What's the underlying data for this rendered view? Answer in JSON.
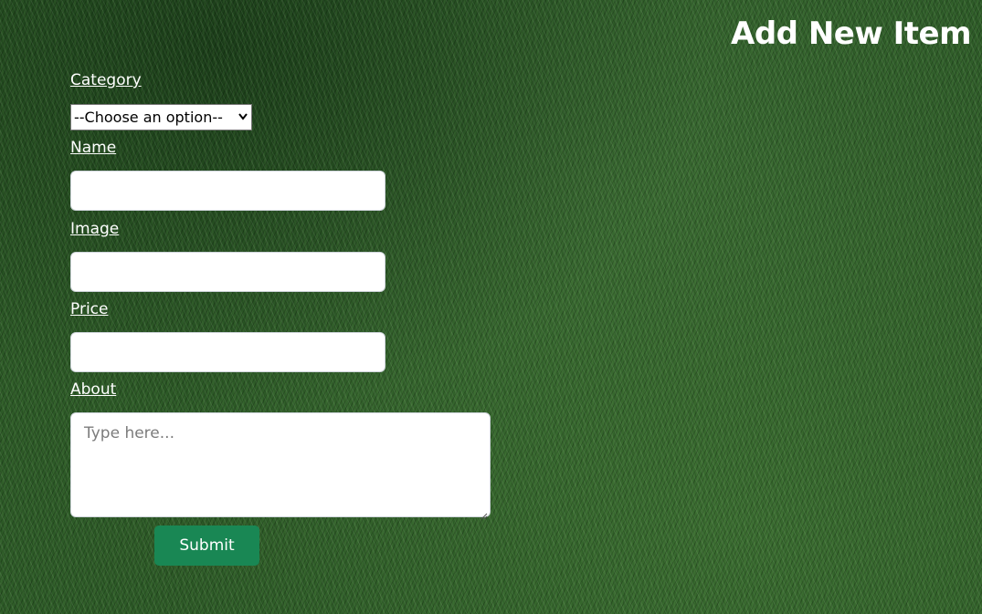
{
  "page": {
    "title": "Add New Item"
  },
  "form": {
    "category": {
      "label": "Category",
      "selected_value": "--Choose an option--"
    },
    "name": {
      "label": "Name",
      "value": ""
    },
    "image": {
      "label": "Image",
      "value": ""
    },
    "price": {
      "label": "Price",
      "value": ""
    },
    "about": {
      "label": "About",
      "placeholder": "Type here..."
    },
    "submit_label": "Submit"
  },
  "colors": {
    "submit_button": "#198754",
    "background_grass": "#2d5a27",
    "text": "#ffffff"
  },
  "icons": {
    "select_arrow": "chevron-down-icon",
    "textarea_resize": "resize-handle-icon"
  }
}
